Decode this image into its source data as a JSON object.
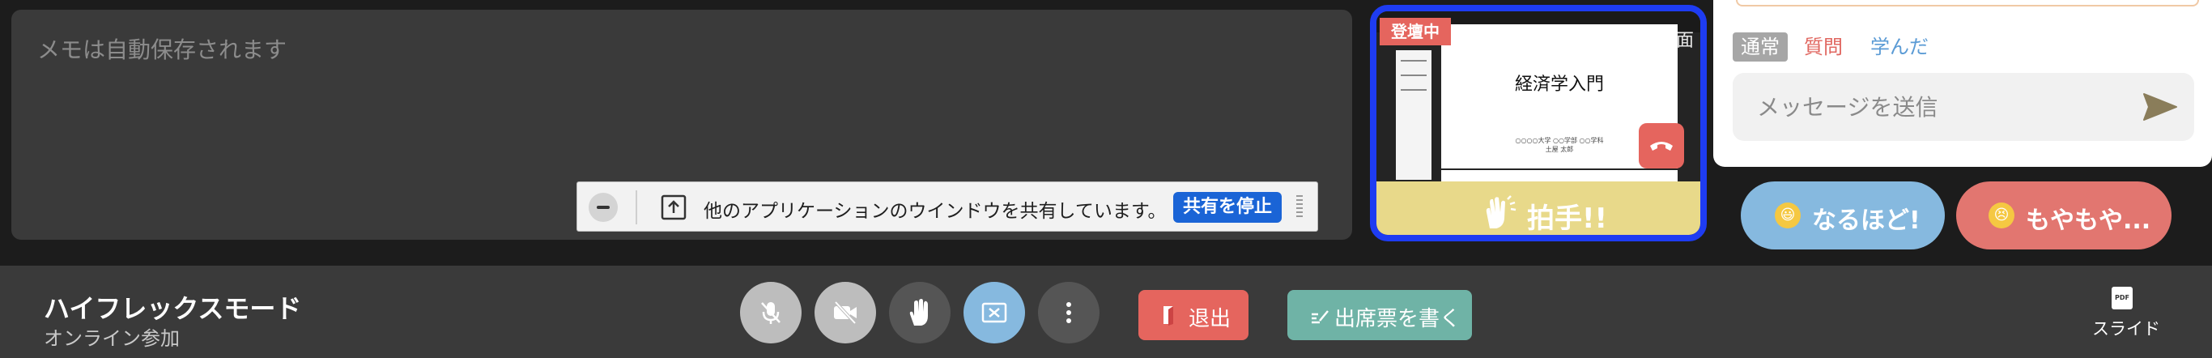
{
  "memo": {
    "placeholder": "メモは自動保存されます"
  },
  "screen_share": {
    "message": "他のアプリケーションのウインドウを共有しています。",
    "stop_label": "共有を停止"
  },
  "camera": {
    "status_badge": "登壇中",
    "slide_corner_label": "画面",
    "slide_title": "経済学入門",
    "slide_subtitle_line1": "○○○○大学 ○○学部 ○○学科",
    "slide_subtitle_line2": "土屋 太郎",
    "applause_label": "拍手!!"
  },
  "chat": {
    "tabs": [
      "通常",
      "質問",
      "学んだ"
    ],
    "input_placeholder": "メッセージを送信"
  },
  "reactions": {
    "agree_label": "なるほど!",
    "agree_emoji": "😃",
    "confused_label": "もやもや...",
    "confused_emoji": "😣"
  },
  "mode": {
    "title": "ハイフレックスモード",
    "subtitle": "オンライン参加"
  },
  "controls": {
    "leave_label": "退出",
    "attendance_label": "出席票を書く",
    "slide_label": "スライド",
    "pdf_badge": "PDF"
  },
  "colors": {
    "accent_blue": "#1e3cf2",
    "danger": "#e5655e",
    "teal": "#6fb3a6",
    "reaction_blue": "#86b9df"
  }
}
